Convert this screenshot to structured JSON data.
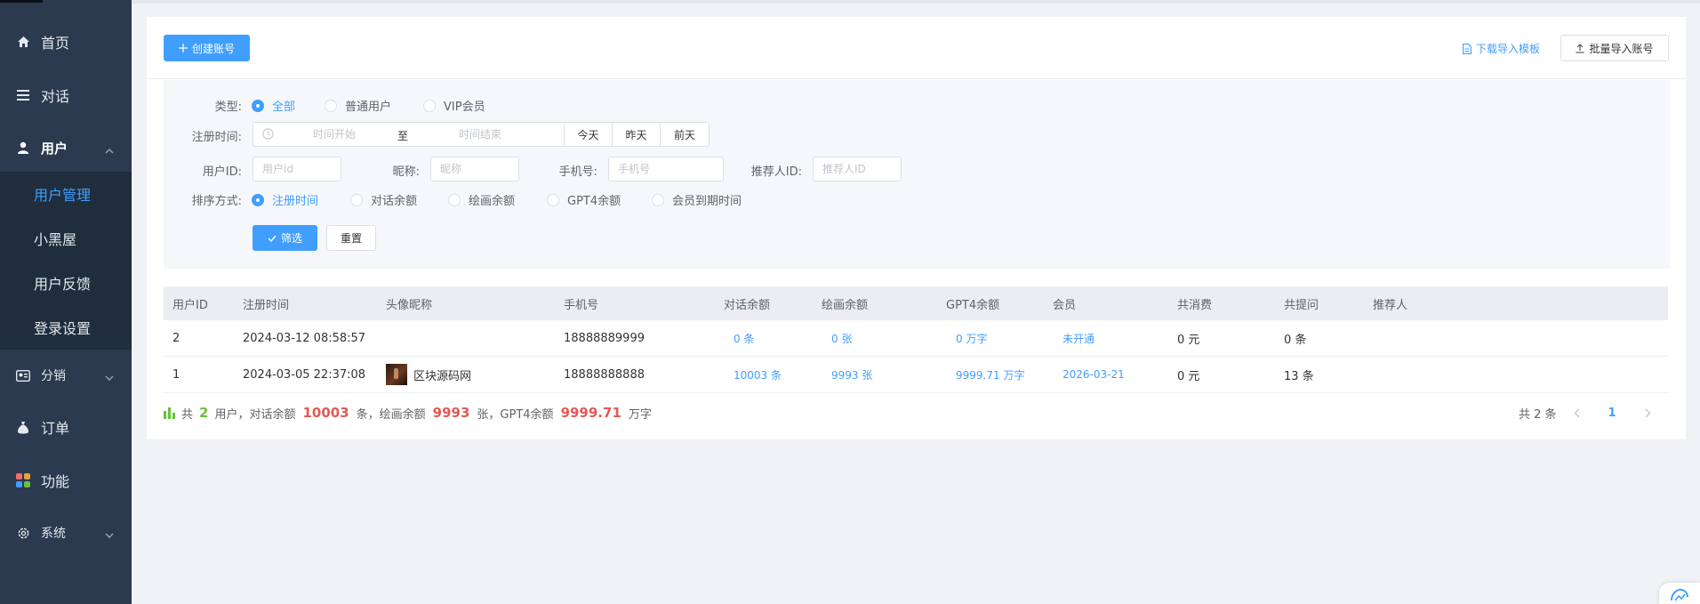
{
  "sidebar": {
    "home": {
      "label": "首页",
      "icon": "home-icon"
    },
    "chat": {
      "label": "对话",
      "icon": "list-icon"
    },
    "users": {
      "label": "用户",
      "icon": "user-icon",
      "children": [
        {
          "label": "用户管理",
          "current": true
        },
        {
          "label": "小黑屋"
        },
        {
          "label": "用户反馈"
        },
        {
          "label": "登录设置"
        }
      ]
    },
    "distribution": {
      "label": "分销",
      "icon": "id-card-icon"
    },
    "orders": {
      "label": "订单",
      "icon": "money-bag-icon"
    },
    "features": {
      "label": "功能",
      "icon": "apps-icon"
    },
    "system": {
      "label": "系统",
      "icon": "gear-icon"
    }
  },
  "toolbar": {
    "create_label": "创建账号",
    "download_template_label": "下载导入模板",
    "batch_import_label": "批量导入账号"
  },
  "filters": {
    "type_label": "类型:",
    "type_options": [
      "全部",
      "普通用户",
      "VIP会员"
    ],
    "type_selected": "全部",
    "reg_time_label": "注册时间:",
    "date_start_placeholder": "时间开始",
    "date_sep": "至",
    "date_end_placeholder": "时间结束",
    "quick_dates": [
      "今天",
      "昨天",
      "前天"
    ],
    "user_id_label": "用户ID:",
    "user_id_placeholder": "用户id",
    "nickname_label": "昵称:",
    "nickname_placeholder": "昵称",
    "phone_label": "手机号:",
    "phone_placeholder": "手机号",
    "referrer_label": "推荐人ID:",
    "referrer_placeholder": "推荐人ID",
    "sort_label": "排序方式:",
    "sort_options": [
      "注册时间",
      "对话余额",
      "绘画余额",
      "GPT4余额",
      "会员到期时间"
    ],
    "sort_selected": "注册时间",
    "filter_label": "筛选",
    "reset_label": "重置"
  },
  "table": {
    "columns": [
      "用户ID",
      "注册时间",
      "头像昵称",
      "手机号",
      "对话余额",
      "绘画余额",
      "GPT4余额",
      "会员",
      "共消费",
      "共提问",
      "推荐人"
    ],
    "rows": [
      {
        "id": "2",
        "reg_time": "2024-03-12 08:58:57",
        "nickname": "",
        "has_avatar": false,
        "phone": "18888889999",
        "chat_balance": "0 条",
        "draw_balance": "0 张",
        "gpt4_balance": "0 万字",
        "member": "未开通",
        "spent": "0 元",
        "questions": "0 条",
        "referrer": ""
      },
      {
        "id": "1",
        "reg_time": "2024-03-05 22:37:08",
        "nickname": "区块源码网",
        "has_avatar": true,
        "phone": "18888888888",
        "chat_balance": "10003 条",
        "draw_balance": "9993 张",
        "gpt4_balance": "9999.71 万字",
        "member": "2026-03-21",
        "spent": "0 元",
        "questions": "13 条",
        "referrer": ""
      }
    ]
  },
  "summary": {
    "t_total": "共",
    "user_count": "2",
    "t_users": "用户，对话余额",
    "chat_total": "10003",
    "t_chat_unit": "条，绘画余额",
    "draw_total": "9993",
    "t_draw_unit": "张，GPT4余额",
    "gpt4_total": "9999.71",
    "t_gpt4_unit": "万字"
  },
  "pagination": {
    "total_text": "共 2 条",
    "current_page": "1"
  },
  "colors": {
    "sidebar_bg": "#2b3a4e",
    "submenu_bg": "#1f2d3d",
    "accent": "#409eff",
    "highlight_red": "#e05a57",
    "highlight_green": "#67c23a"
  }
}
